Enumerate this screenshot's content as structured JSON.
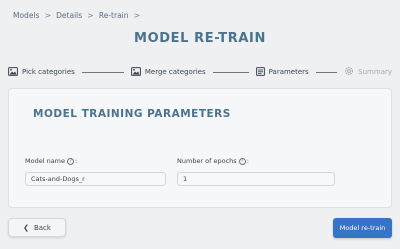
{
  "breadcrumb": {
    "items": [
      "Models",
      "Details",
      "Re-train"
    ],
    "separator": ">"
  },
  "page": {
    "title": "MODEL RE-TRAIN"
  },
  "steps": {
    "items": [
      {
        "label": "Pick categories",
        "icon": "image-icon"
      },
      {
        "label": "Merge categories",
        "icon": "image-icon"
      },
      {
        "label": "Parameters",
        "icon": "list-icon"
      },
      {
        "label": "Summary",
        "icon": "gear-icon",
        "state": "disabled"
      }
    ]
  },
  "form": {
    "title": "MODEL TRAINING PARAMETERS",
    "model_name": {
      "label": "Model name",
      "suffix": ":",
      "value": "Cats-and-Dogs_r"
    },
    "epochs": {
      "label": "Number of epochs",
      "suffix": ":",
      "value": "1"
    },
    "help_glyph": "?"
  },
  "actions": {
    "back_label": "Back",
    "back_arrow": "❮",
    "submit_label": "Model re-train"
  },
  "colors": {
    "accent": "#4a7390",
    "primary_button": "#3773c6",
    "background": "#eef0f2"
  }
}
